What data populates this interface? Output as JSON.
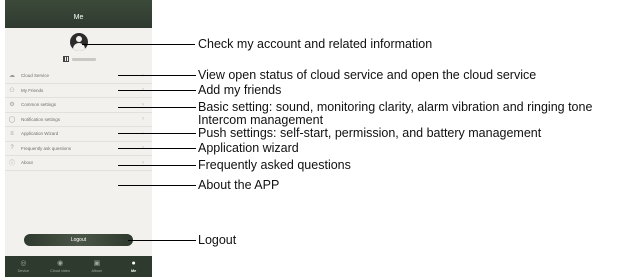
{
  "screen": {
    "title": "Me"
  },
  "menu": {
    "items": [
      {
        "label": "Cloud Service",
        "icon": "cloud-icon",
        "glyph": "☁"
      },
      {
        "label": "My Friends",
        "icon": "person-icon",
        "glyph": "⚇"
      },
      {
        "label": "Common settings",
        "icon": "gear-icon",
        "glyph": "⚙"
      },
      {
        "label": "Notification settings",
        "icon": "bell-icon",
        "glyph": "◯"
      },
      {
        "label": "Application Wizard",
        "icon": "list-icon",
        "glyph": "≡"
      },
      {
        "label": "Frequently ask questions",
        "icon": "question-icon",
        "glyph": "?"
      },
      {
        "label": "About",
        "icon": "info-icon",
        "glyph": "ⓘ"
      }
    ]
  },
  "logout": {
    "label": "Logout"
  },
  "tabbar": {
    "tabs": [
      {
        "label": "Device",
        "icon": "camera-icon",
        "glyph": "◎",
        "active": false
      },
      {
        "label": "Cloud video",
        "icon": "cloud-video-icon",
        "glyph": "◉",
        "active": false
      },
      {
        "label": "Album",
        "icon": "album-icon",
        "glyph": "▣",
        "active": false
      },
      {
        "label": "Me",
        "icon": "me-icon",
        "glyph": "●",
        "active": true
      }
    ]
  },
  "callouts": {
    "account": "Check my account and related information",
    "cloud": "View open status of cloud service and open the cloud service",
    "friends": "Add my friends",
    "basic_line1": "Basic setting: sound, monitoring clarity, alarm vibration and ringing tone",
    "basic_line2": "Intercom management",
    "push": "Push settings: self-start, permission, and battery management",
    "wizard": "Application wizard",
    "faq": "Frequently asked questions",
    "about": "About the APP",
    "logout": "Logout"
  },
  "colors": {
    "header": "#2f3a2f",
    "background": "#f2f1ee",
    "tabbar": "#2f3a2f"
  }
}
